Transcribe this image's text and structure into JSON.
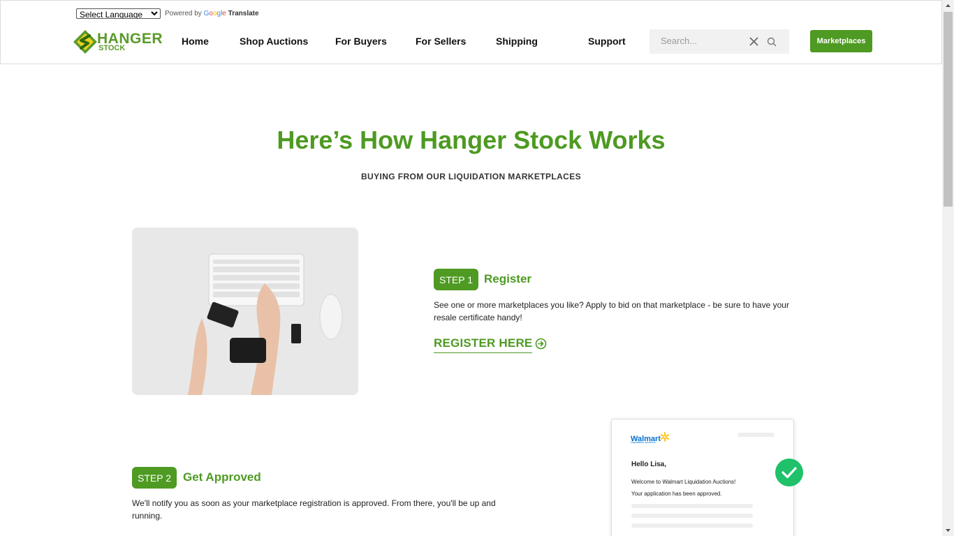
{
  "translate": {
    "select_label": "Select Language",
    "powered_by": "Powered by",
    "google": "Google",
    "translate": "Translate"
  },
  "logo": {
    "line1": "HANGER",
    "line2": "STOCK"
  },
  "nav": [
    {
      "label": "Home"
    },
    {
      "label": "Shop Auctions"
    },
    {
      "label": "For Buyers"
    },
    {
      "label": "For Sellers"
    },
    {
      "label": "Shipping"
    },
    {
      "label": "Support"
    }
  ],
  "search": {
    "placeholder": "Search..."
  },
  "marketplaces_button": "Marketplaces",
  "hero": {
    "title": "Here’s How Hanger Stock Works",
    "subtitle": "BUYING FROM OUR LIQUIDATION MARKETPLACES"
  },
  "step1": {
    "badge": "STEP 1",
    "title": "Register",
    "text": "See one or more marketplaces you like? Apply to bid on that marketplace - be sure to have your resale certificate handy!",
    "link": "REGISTER HERE"
  },
  "step2": {
    "badge": "STEP 2",
    "title": "Get Approved",
    "text": "We'll notify you as soon as your marketplace registration is approved. From there, you'll be up and running."
  },
  "card": {
    "brand": "Walmart",
    "brand_sub": "Liquidation Auctions",
    "hello": "Hello Lisa,",
    "welcome": "Welcome to Walmart Liquidation Auctions!",
    "approved": "Your application has been approved."
  },
  "colors": {
    "brand_green": "#4e9a22",
    "check_green": "#1fc16b"
  }
}
